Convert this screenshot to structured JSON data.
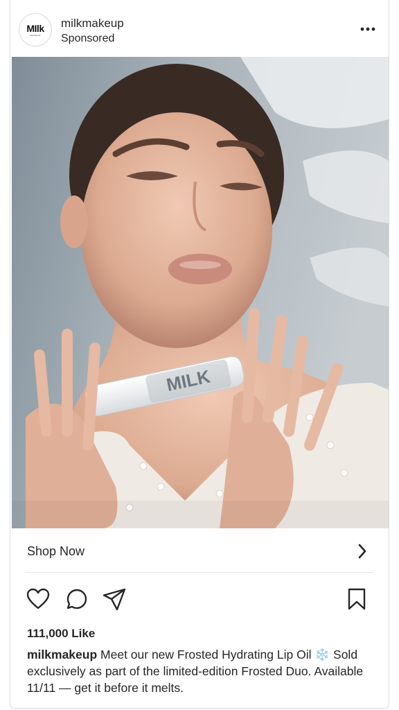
{
  "post": {
    "username": "milkmakeup",
    "sponsored_label": "Sponsored",
    "avatar_logo": "MIlk",
    "avatar_sub": "MAKEUP",
    "product_label": "MILK"
  },
  "cta": {
    "label": "Shop Now"
  },
  "stats": {
    "likes": "111,000 Like"
  },
  "caption": {
    "username": "milkmakeup",
    "text": "Meet our new Frosted Hydrating Lip Oil",
    "emoji": "❄️",
    "text2": "Sold exclusively as part of the limited-edition Frosted Duo. Available 11/11 — get it before it melts."
  },
  "icons": {
    "more": "more-horizontal-icon",
    "like": "heart-icon",
    "comment": "comment-icon",
    "share": "send-icon",
    "save": "bookmark-icon",
    "chevron": "chevron-right-icon"
  },
  "colors": {
    "text": "#262626",
    "border": "#dbdbdb",
    "snowflake": "#7fb5e0"
  }
}
